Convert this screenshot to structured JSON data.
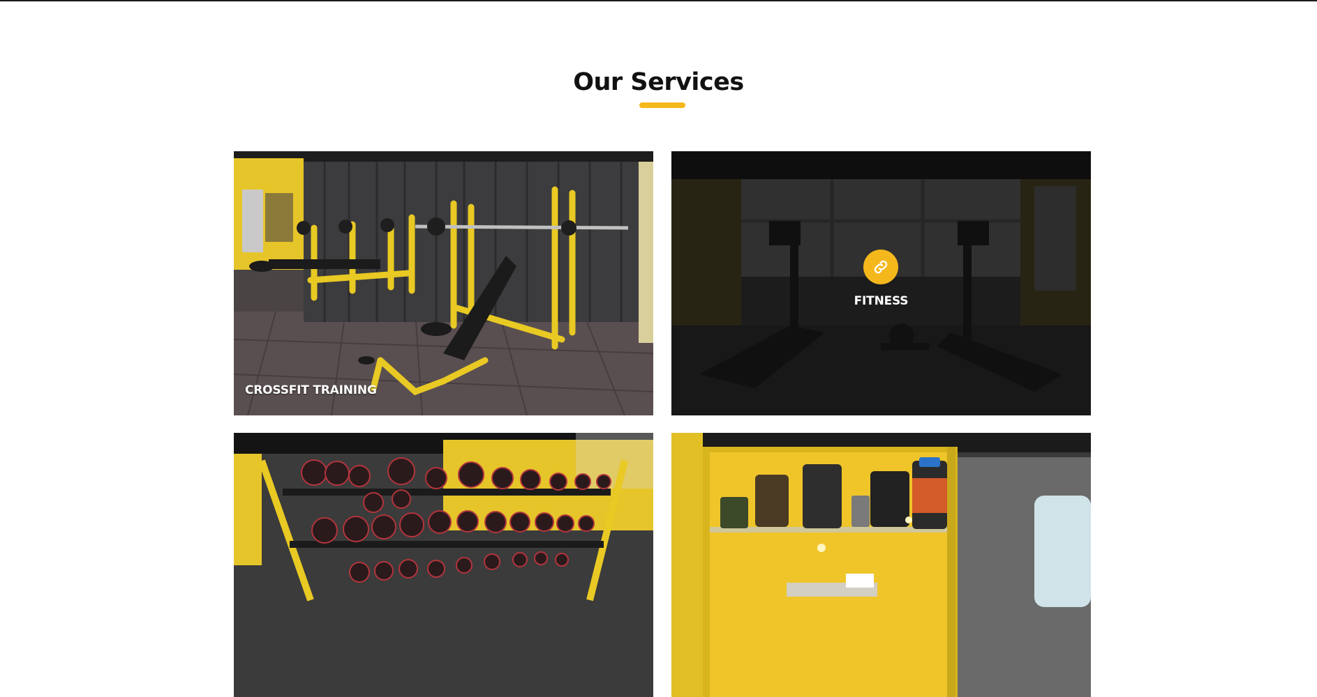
{
  "section": {
    "title": "Our Services",
    "accent_color": "#f5b81c"
  },
  "services": [
    {
      "label": "CROSSFIT TRAINING",
      "image": "bench-press-room-photo"
    },
    {
      "label": "FITNESS",
      "image": "treadmill-room-photo",
      "hover_icon": "link-icon"
    },
    {
      "label": "",
      "image": "dumbbell-rack-photo"
    },
    {
      "label": "",
      "image": "supplement-shelf-photo"
    }
  ]
}
